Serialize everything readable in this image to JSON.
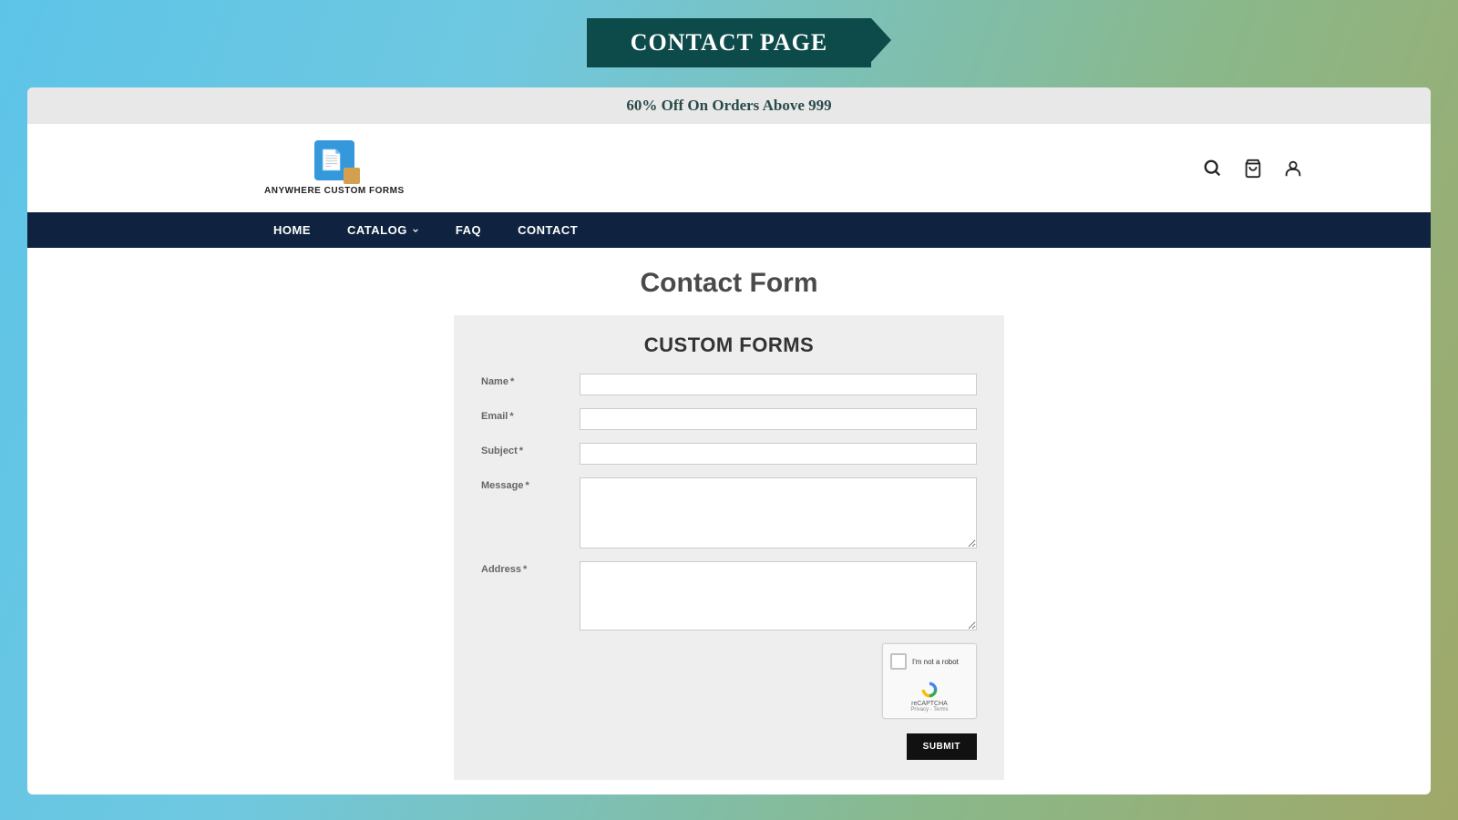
{
  "badge": "CONTACT PAGE",
  "promo": "60% Off On Orders Above 999",
  "logo_text": "ANYWHERE CUSTOM FORMS",
  "nav": {
    "home": "HOME",
    "catalog": "CATALOG",
    "faq": "FAQ",
    "contact": "CONTACT"
  },
  "page_title": "Contact Form",
  "form_title": "CUSTOM FORMS",
  "labels": {
    "name": "Name",
    "email": "Email",
    "subject": "Subject",
    "message": "Message",
    "address": "Address"
  },
  "captcha": {
    "text": "I'm not a robot",
    "brand": "reCAPTCHA",
    "links": "Privacy - Terms"
  },
  "submit": "SUBMIT"
}
